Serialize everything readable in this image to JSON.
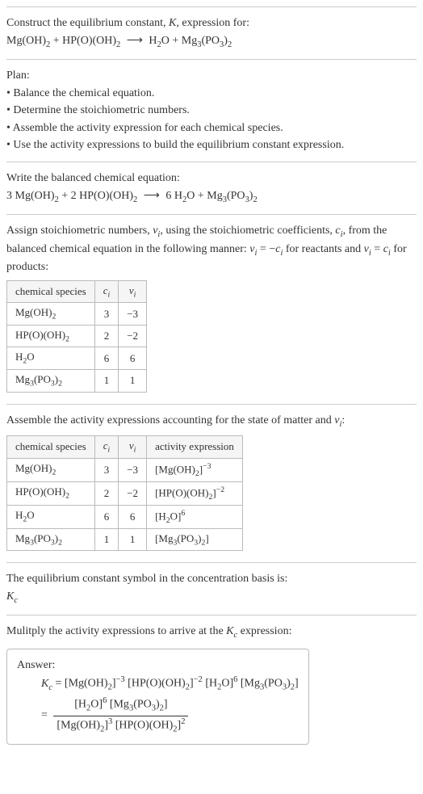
{
  "intro": {
    "title": "Construct the equilibrium constant, K, expression for:",
    "equation": "Mg(OH)₂ + HP(O)(OH)₂  ⟶  H₂O + Mg₃(PO₃)₂"
  },
  "plan": {
    "heading": "Plan:",
    "b1": "• Balance the chemical equation.",
    "b2": "• Determine the stoichiometric numbers.",
    "b3": "• Assemble the activity expression for each chemical species.",
    "b4": "• Use the activity expressions to build the equilibrium constant expression."
  },
  "balanced": {
    "heading": "Write the balanced chemical equation:",
    "equation": "3 Mg(OH)₂ + 2 HP(O)(OH)₂  ⟶  6 H₂O + Mg₃(PO₃)₂"
  },
  "assign": {
    "text": "Assign stoichiometric numbers, νᵢ, using the stoichiometric coefficients, cᵢ, from the balanced chemical equation in the following manner: νᵢ = −cᵢ for reactants and νᵢ = cᵢ for products:",
    "headers": {
      "h1": "chemical species",
      "h2": "cᵢ",
      "h3": "νᵢ"
    },
    "rows": [
      {
        "sp": "Mg(OH)₂",
        "c": "3",
        "v": "−3"
      },
      {
        "sp": "HP(O)(OH)₂",
        "c": "2",
        "v": "−2"
      },
      {
        "sp": "H₂O",
        "c": "6",
        "v": "6"
      },
      {
        "sp": "Mg₃(PO₃)₂",
        "c": "1",
        "v": "1"
      }
    ]
  },
  "assemble": {
    "text": "Assemble the activity expressions accounting for the state of matter and νᵢ:",
    "headers": {
      "h1": "chemical species",
      "h2": "cᵢ",
      "h3": "νᵢ",
      "h4": "activity expression"
    },
    "rows": [
      {
        "sp": "Mg(OH)₂",
        "c": "3",
        "v": "−3",
        "a": "[Mg(OH)₂]⁻³"
      },
      {
        "sp": "HP(O)(OH)₂",
        "c": "2",
        "v": "−2",
        "a": "[HP(O)(OH)₂]⁻²"
      },
      {
        "sp": "H₂O",
        "c": "6",
        "v": "6",
        "a": "[H₂O]⁶"
      },
      {
        "sp": "Mg₃(PO₃)₂",
        "c": "1",
        "v": "1",
        "a": "[Mg₃(PO₃)₂]"
      }
    ]
  },
  "symbol": {
    "text": "The equilibrium constant symbol in the concentration basis is:",
    "value": "K_c"
  },
  "multiply": {
    "text": "Mulitply the activity expressions to arrive at the K_c expression:"
  },
  "answer": {
    "label": "Answer:",
    "line1": "K_c = [Mg(OH)₂]⁻³ [HP(O)(OH)₂]⁻² [H₂O]⁶ [Mg₃(PO₃)₂]",
    "frac_num": "[H₂O]⁶ [Mg₃(PO₃)₂]",
    "frac_den": "[Mg(OH)₂]³ [HP(O)(OH)₂]²",
    "eq": "="
  }
}
